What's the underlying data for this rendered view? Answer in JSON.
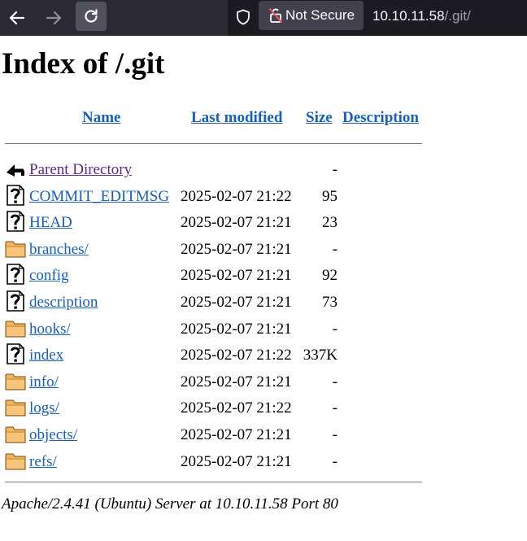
{
  "browser": {
    "security_label": "Not Secure",
    "url_host": "10.10.11.58",
    "url_path": "/.git/"
  },
  "page": {
    "title": "Index of /.git",
    "columns": {
      "name": "Name",
      "last_modified": "Last modified",
      "size": "Size",
      "description": "Description"
    },
    "rows": [
      {
        "name": "Parent Directory",
        "date": "",
        "size": "-",
        "icon": "back-icon",
        "visited": true
      },
      {
        "name": "COMMIT_EDITMSG",
        "date": "2025-02-07 21:22",
        "size": "95",
        "icon": "unknown-file-icon"
      },
      {
        "name": "HEAD",
        "date": "2025-02-07 21:21",
        "size": "23",
        "icon": "unknown-file-icon"
      },
      {
        "name": "branches/",
        "date": "2025-02-07 21:21",
        "size": "-",
        "icon": "folder-icon"
      },
      {
        "name": "config",
        "date": "2025-02-07 21:21",
        "size": "92",
        "icon": "unknown-file-icon"
      },
      {
        "name": "description",
        "date": "2025-02-07 21:21",
        "size": "73",
        "icon": "unknown-file-icon"
      },
      {
        "name": "hooks/",
        "date": "2025-02-07 21:21",
        "size": "-",
        "icon": "folder-icon"
      },
      {
        "name": "index",
        "date": "2025-02-07 21:22",
        "size": "337K",
        "icon": "unknown-file-icon"
      },
      {
        "name": "info/",
        "date": "2025-02-07 21:21",
        "size": "-",
        "icon": "folder-icon"
      },
      {
        "name": "logs/",
        "date": "2025-02-07 21:22",
        "size": "-",
        "icon": "folder-icon"
      },
      {
        "name": "objects/",
        "date": "2025-02-07 21:21",
        "size": "-",
        "icon": "folder-icon"
      },
      {
        "name": "refs/",
        "date": "2025-02-07 21:21",
        "size": "-",
        "icon": "folder-icon"
      }
    ],
    "footer": "Apache/2.4.41 (Ubuntu) Server at 10.10.11.58 Port 80"
  }
}
